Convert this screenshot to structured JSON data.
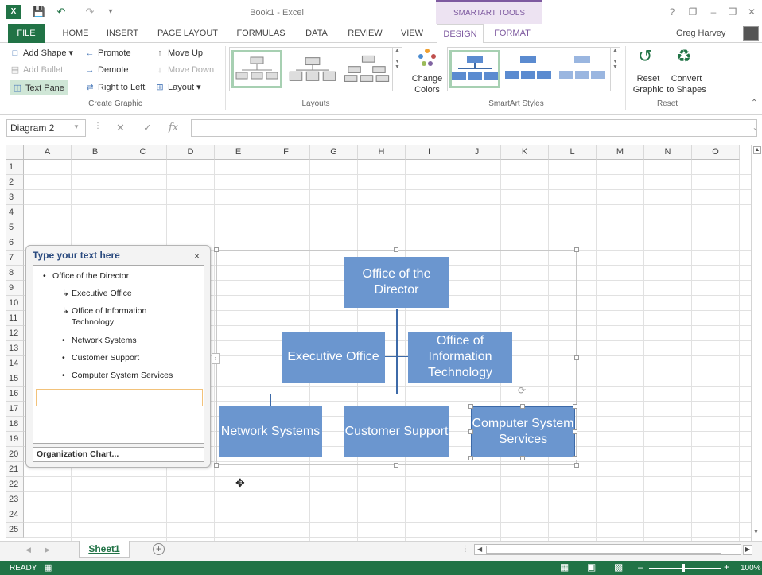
{
  "titlebar": {
    "doc_title": "Book1 - Excel",
    "tools_label": "SMARTART TOOLS",
    "user": "Greg Harvey",
    "help": "?",
    "minimize": "–",
    "restore": "❐",
    "close": "✕"
  },
  "tabs": [
    "FILE",
    "HOME",
    "INSERT",
    "PAGE LAYOUT",
    "FORMULAS",
    "DATA",
    "REVIEW",
    "VIEW",
    "DESIGN",
    "FORMAT"
  ],
  "ribbon": {
    "create_graphic": {
      "label": "Create Graphic",
      "add_shape": "Add Shape",
      "add_bullet": "Add Bullet",
      "text_pane": "Text Pane",
      "promote": "Promote",
      "demote": "Demote",
      "right_to_left": "Right to Left",
      "move_up": "Move Up",
      "move_down": "Move Down",
      "layout": "Layout"
    },
    "layouts": {
      "label": "Layouts"
    },
    "smartart_styles": {
      "label": "SmartArt Styles",
      "change_colors_1": "Change",
      "change_colors_2": "Colors"
    },
    "reset": {
      "label": "Reset",
      "reset_graphic_1": "Reset",
      "reset_graphic_2": "Graphic",
      "convert_1": "Convert",
      "convert_2": "to Shapes"
    }
  },
  "formula_bar": {
    "name_box": "Diagram 2",
    "fx": "fx",
    "value": ""
  },
  "grid": {
    "columns": [
      "A",
      "B",
      "C",
      "D",
      "E",
      "F",
      "G",
      "H",
      "I",
      "J",
      "K",
      "L",
      "M",
      "N",
      "O"
    ],
    "rows": [
      "1",
      "2",
      "3",
      "4",
      "5",
      "6",
      "7",
      "8",
      "9",
      "10",
      "11",
      "12",
      "13",
      "14",
      "15",
      "16",
      "17",
      "18",
      "19",
      "20",
      "21",
      "22",
      "23",
      "24",
      "25"
    ]
  },
  "text_pane": {
    "title": "Type your text here",
    "close": "×",
    "items": [
      {
        "level": 1,
        "text": "Office of the Director"
      },
      {
        "level": 2,
        "text": "Executive Office"
      },
      {
        "level": 2,
        "text": "Office of Information Technology"
      },
      {
        "level": 2,
        "text": "Network Systems"
      },
      {
        "level": 2,
        "text": "Customer Support"
      },
      {
        "level": 2,
        "text": "Computer System Services"
      }
    ],
    "footer": "Organization Chart..."
  },
  "smartart": {
    "director": "Office of the Director",
    "executive": "Executive Office",
    "it": "Office of Information Technology",
    "network": "Network Systems",
    "support": "Customer Support",
    "services": "Computer System Services"
  },
  "sheets": {
    "active": "Sheet1",
    "add": "+"
  },
  "status": {
    "ready": "READY",
    "zoom": "100%"
  },
  "colors": {
    "excel_green": "#217346",
    "smartart_fill": "#6b96cf",
    "tools_purple": "#7e5aa0"
  }
}
